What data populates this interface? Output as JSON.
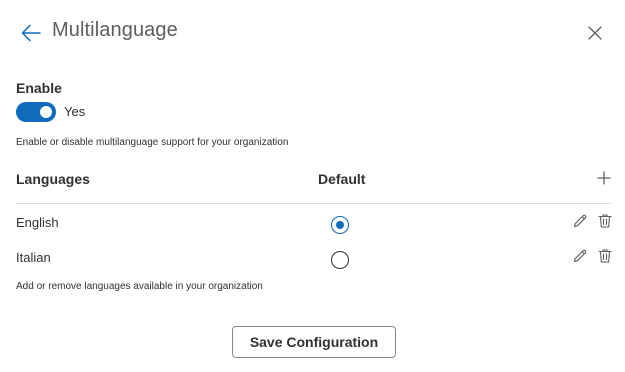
{
  "header": {
    "title": "Multilanguage",
    "back_icon": "arrow-left-icon",
    "close_icon": "close-icon"
  },
  "enable": {
    "label": "Enable",
    "toggle_on": true,
    "toggle_state": "Yes",
    "helper": "Enable or disable multilanguage support for your organization"
  },
  "languages": {
    "col_language": "Languages",
    "col_default": "Default",
    "add_icon": "plus-icon",
    "rows": [
      {
        "name": "English",
        "is_default": true
      },
      {
        "name": "Italian",
        "is_default": false
      }
    ],
    "helper": "Add or remove languages available in your organization"
  },
  "footer": {
    "save_label": "Save Configuration"
  },
  "colors": {
    "accent": "#0f6cbd",
    "text": "#323130",
    "muted": "#605e5c",
    "divider": "#e1dfdd",
    "button_border": "#8a8886"
  }
}
